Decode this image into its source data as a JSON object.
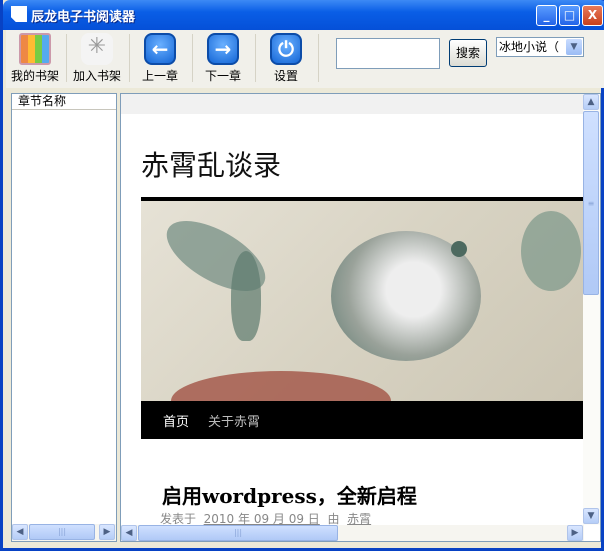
{
  "window": {
    "title": "辰龙电子书阅读器",
    "minimize": "_",
    "maximize": "□",
    "close": "X"
  },
  "toolbar": {
    "items": [
      {
        "label": "我的书架",
        "icon": "bookshelf-icon"
      },
      {
        "label": "加入书架",
        "icon": "add-shelf-icon"
      },
      {
        "label": "上一章",
        "icon": "arrow-left-icon"
      },
      {
        "label": "下一章",
        "icon": "arrow-right-icon"
      },
      {
        "label": "设置",
        "icon": "power-icon"
      }
    ],
    "search_value": "",
    "search_label": "搜索",
    "source_selected": "冰地小说（"
  },
  "chapters": {
    "header": "章节名称"
  },
  "page": {
    "site_title": "赤霄乱谈录",
    "nav": [
      "首页",
      "关于赤霄"
    ],
    "post_title": "启用wordpress，全新启程",
    "meta_prefix": "发表于",
    "meta_date": "2010 年 09 月 09 日",
    "meta_by": "由",
    "meta_author": "赤霄"
  }
}
